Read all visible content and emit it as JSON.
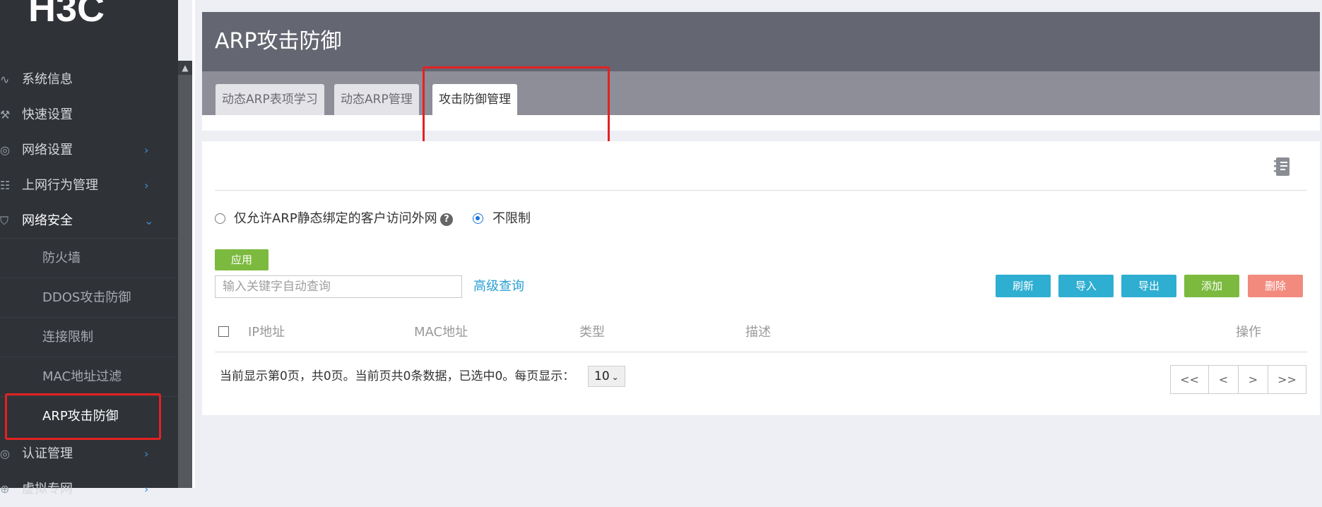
{
  "brand": {
    "logo_text": "H3C"
  },
  "sidebar": {
    "items": [
      {
        "label": "系统信息",
        "icon": "pulse-icon"
      },
      {
        "label": "快速设置",
        "icon": "wrench-icon"
      },
      {
        "label": "网络设置",
        "icon": "globe-icon"
      },
      {
        "label": "上网行为管理",
        "icon": "sitemap-icon"
      },
      {
        "label": "网络安全",
        "icon": "shield-icon",
        "expanded": true
      },
      {
        "label": "认证管理",
        "icon": "globe-icon"
      },
      {
        "label": "虚拟专网",
        "icon": "network-icon"
      }
    ],
    "security_children": [
      {
        "label": "防火墙"
      },
      {
        "label": "DDOS攻击防御"
      },
      {
        "label": "连接限制"
      },
      {
        "label": "MAC地址过滤"
      },
      {
        "label": "ARP攻击防御",
        "active": true
      }
    ]
  },
  "header": {
    "title": "ARP攻击防御"
  },
  "tabs": [
    {
      "label": "动态ARP表项学习"
    },
    {
      "label": "动态ARP管理"
    },
    {
      "label": "攻击防御管理",
      "active": true
    }
  ],
  "options": {
    "radio1_label": "仅允许ARP静态绑定的客户访问外网",
    "radio2_label": "不限制",
    "help_mark": "?",
    "selected": "不限制"
  },
  "apply_label": "应用",
  "search": {
    "placeholder": "输入关键字自动查询",
    "value": ""
  },
  "advanced_query_label": "高级查询",
  "actions": {
    "refresh": "刷新",
    "import": "导入",
    "export": "导出",
    "add": "添加",
    "delete": "删除"
  },
  "table": {
    "columns": [
      "IP地址",
      "MAC地址",
      "类型",
      "描述",
      "操作"
    ],
    "rows": []
  },
  "pager": {
    "summary": "当前显示第0页，共0页。当前页共0条数据，已选中0。每页显示：",
    "page_size": "10",
    "first": "<<",
    "prev": "<",
    "next": ">",
    "last": ">>"
  },
  "colors": {
    "sidebar_bg": "#2f3237",
    "header_bg": "#646671",
    "tabbar_bg": "#8d8e98",
    "info_blue": "#2eaed1",
    "success_green": "#7cba3f",
    "danger_red": "#f28a7e",
    "highlight_red": "#e32222"
  }
}
